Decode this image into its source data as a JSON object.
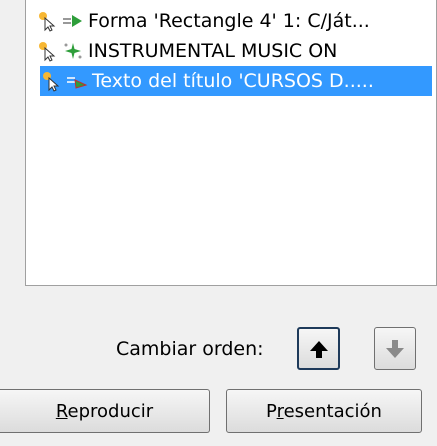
{
  "animation_list": {
    "items": [
      {
        "label": "Forma 'Rectangle 4' 1: C/Ját...",
        "trigger_icon": "click-cursor-icon",
        "effect_icon": "arrow-right-effect-icon",
        "selected": false
      },
      {
        "label": "INSTRUMENTAL MUSIC ON",
        "trigger_icon": "click-cursor-icon",
        "effect_icon": "sparkle-effect-icon",
        "selected": false
      },
      {
        "label": "Texto del título 'CURSOS D.....",
        "trigger_icon": "click-cursor-icon",
        "effect_icon": "fly-in-effect-icon",
        "selected": true
      }
    ]
  },
  "reorder": {
    "label": "Cambiar orden:",
    "up_icon": "arrow-up-icon",
    "down_icon": "arrow-down-icon"
  },
  "footer": {
    "play_label_prefix": "",
    "play_label_underlined": "R",
    "play_label_rest": "eproducir",
    "present_label_prefix": "P",
    "present_label_underlined": "r",
    "present_label_rest": "esentación"
  },
  "colors": {
    "selection": "#3399ff",
    "window_bg": "#f0f0f0"
  }
}
